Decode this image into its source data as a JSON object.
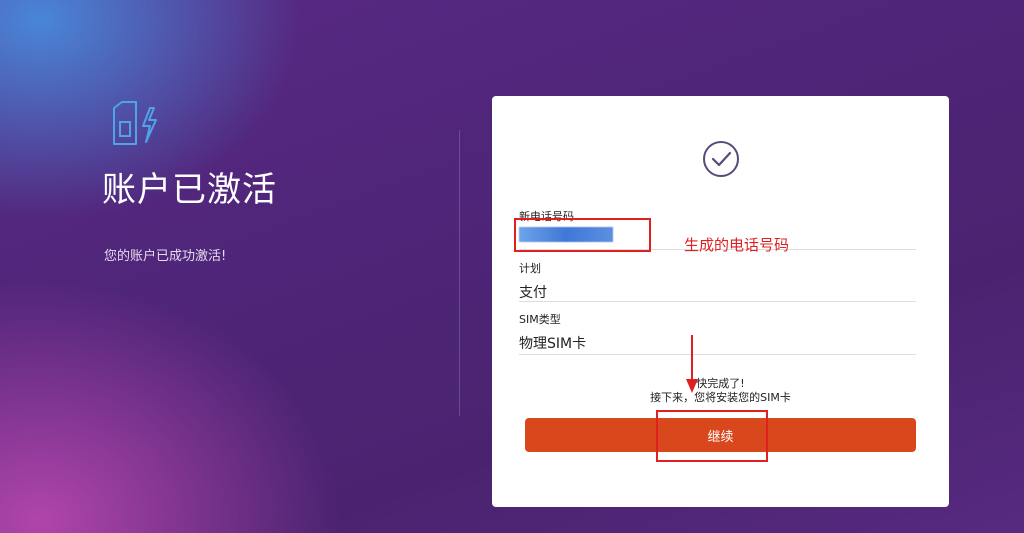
{
  "left_panel": {
    "icon": "sim-card-lightning-icon",
    "title": "账户已激活",
    "subtitle": "您的账户已成功激活!"
  },
  "card": {
    "status_icon": "checkmark-circle-icon",
    "fields": [
      {
        "label": "新电话号码",
        "value": ""
      },
      {
        "label": "计划",
        "value": "支付"
      },
      {
        "label": "SIM类型",
        "value": "物理SIM卡"
      }
    ],
    "done_line1": "快完成了!",
    "done_line2": "接下来，您将安装您的SIM卡",
    "continue_label": "继续"
  },
  "annotation": {
    "phone_note": "生成的电话号码",
    "color": "#e02020"
  },
  "colors": {
    "accent": "#d9471d",
    "background": "#4e2578"
  }
}
